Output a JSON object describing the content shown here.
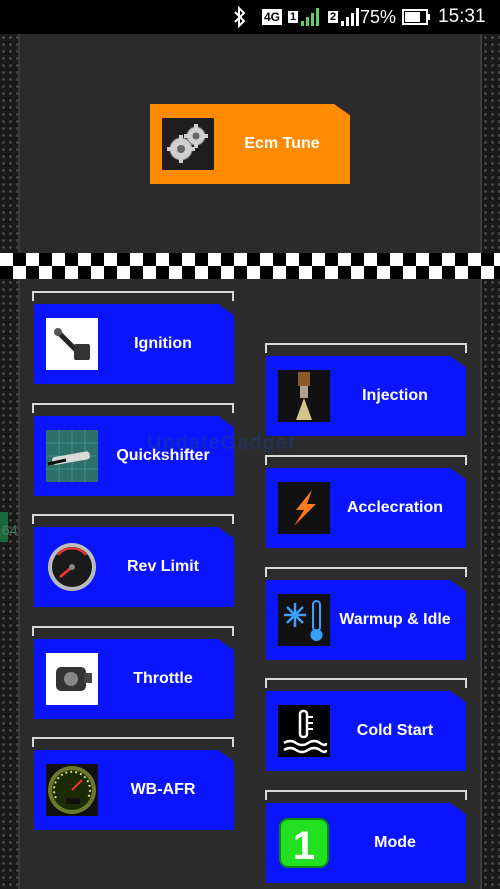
{
  "status_bar": {
    "network": "4G",
    "sim1": "1",
    "sim2": "2",
    "battery": "75%",
    "time": "15:31"
  },
  "top_button": {
    "label": "Ecm Tune",
    "icon": "gears-icon",
    "color": "#ff8c00"
  },
  "left_column": [
    {
      "label": "Ignition",
      "icon": "ignition-coil-icon"
    },
    {
      "label": "Quickshifter",
      "icon": "quickshifter-sensor-icon"
    },
    {
      "label": "Rev Limit",
      "icon": "tachometer-icon"
    },
    {
      "label": "Throttle",
      "icon": "throttle-sensor-icon"
    },
    {
      "label": "WB-AFR",
      "icon": "afr-gauge-icon"
    }
  ],
  "right_column": [
    {
      "label": "Injection",
      "icon": "fuel-injector-icon"
    },
    {
      "label": "Acclecration",
      "icon": "lightning-icon"
    },
    {
      "label": "Warmup & Idle",
      "icon": "snowflake-thermometer-icon"
    },
    {
      "label": "Cold Start",
      "icon": "coolant-temp-icon"
    },
    {
      "label": "Mode",
      "icon": "mode-one-icon"
    }
  ],
  "watermark": "UpdateGadget",
  "side_fragment": "64",
  "colors": {
    "tile": "#0a14ff",
    "accent": "#ff8c00",
    "background": "#2b2b2b"
  }
}
